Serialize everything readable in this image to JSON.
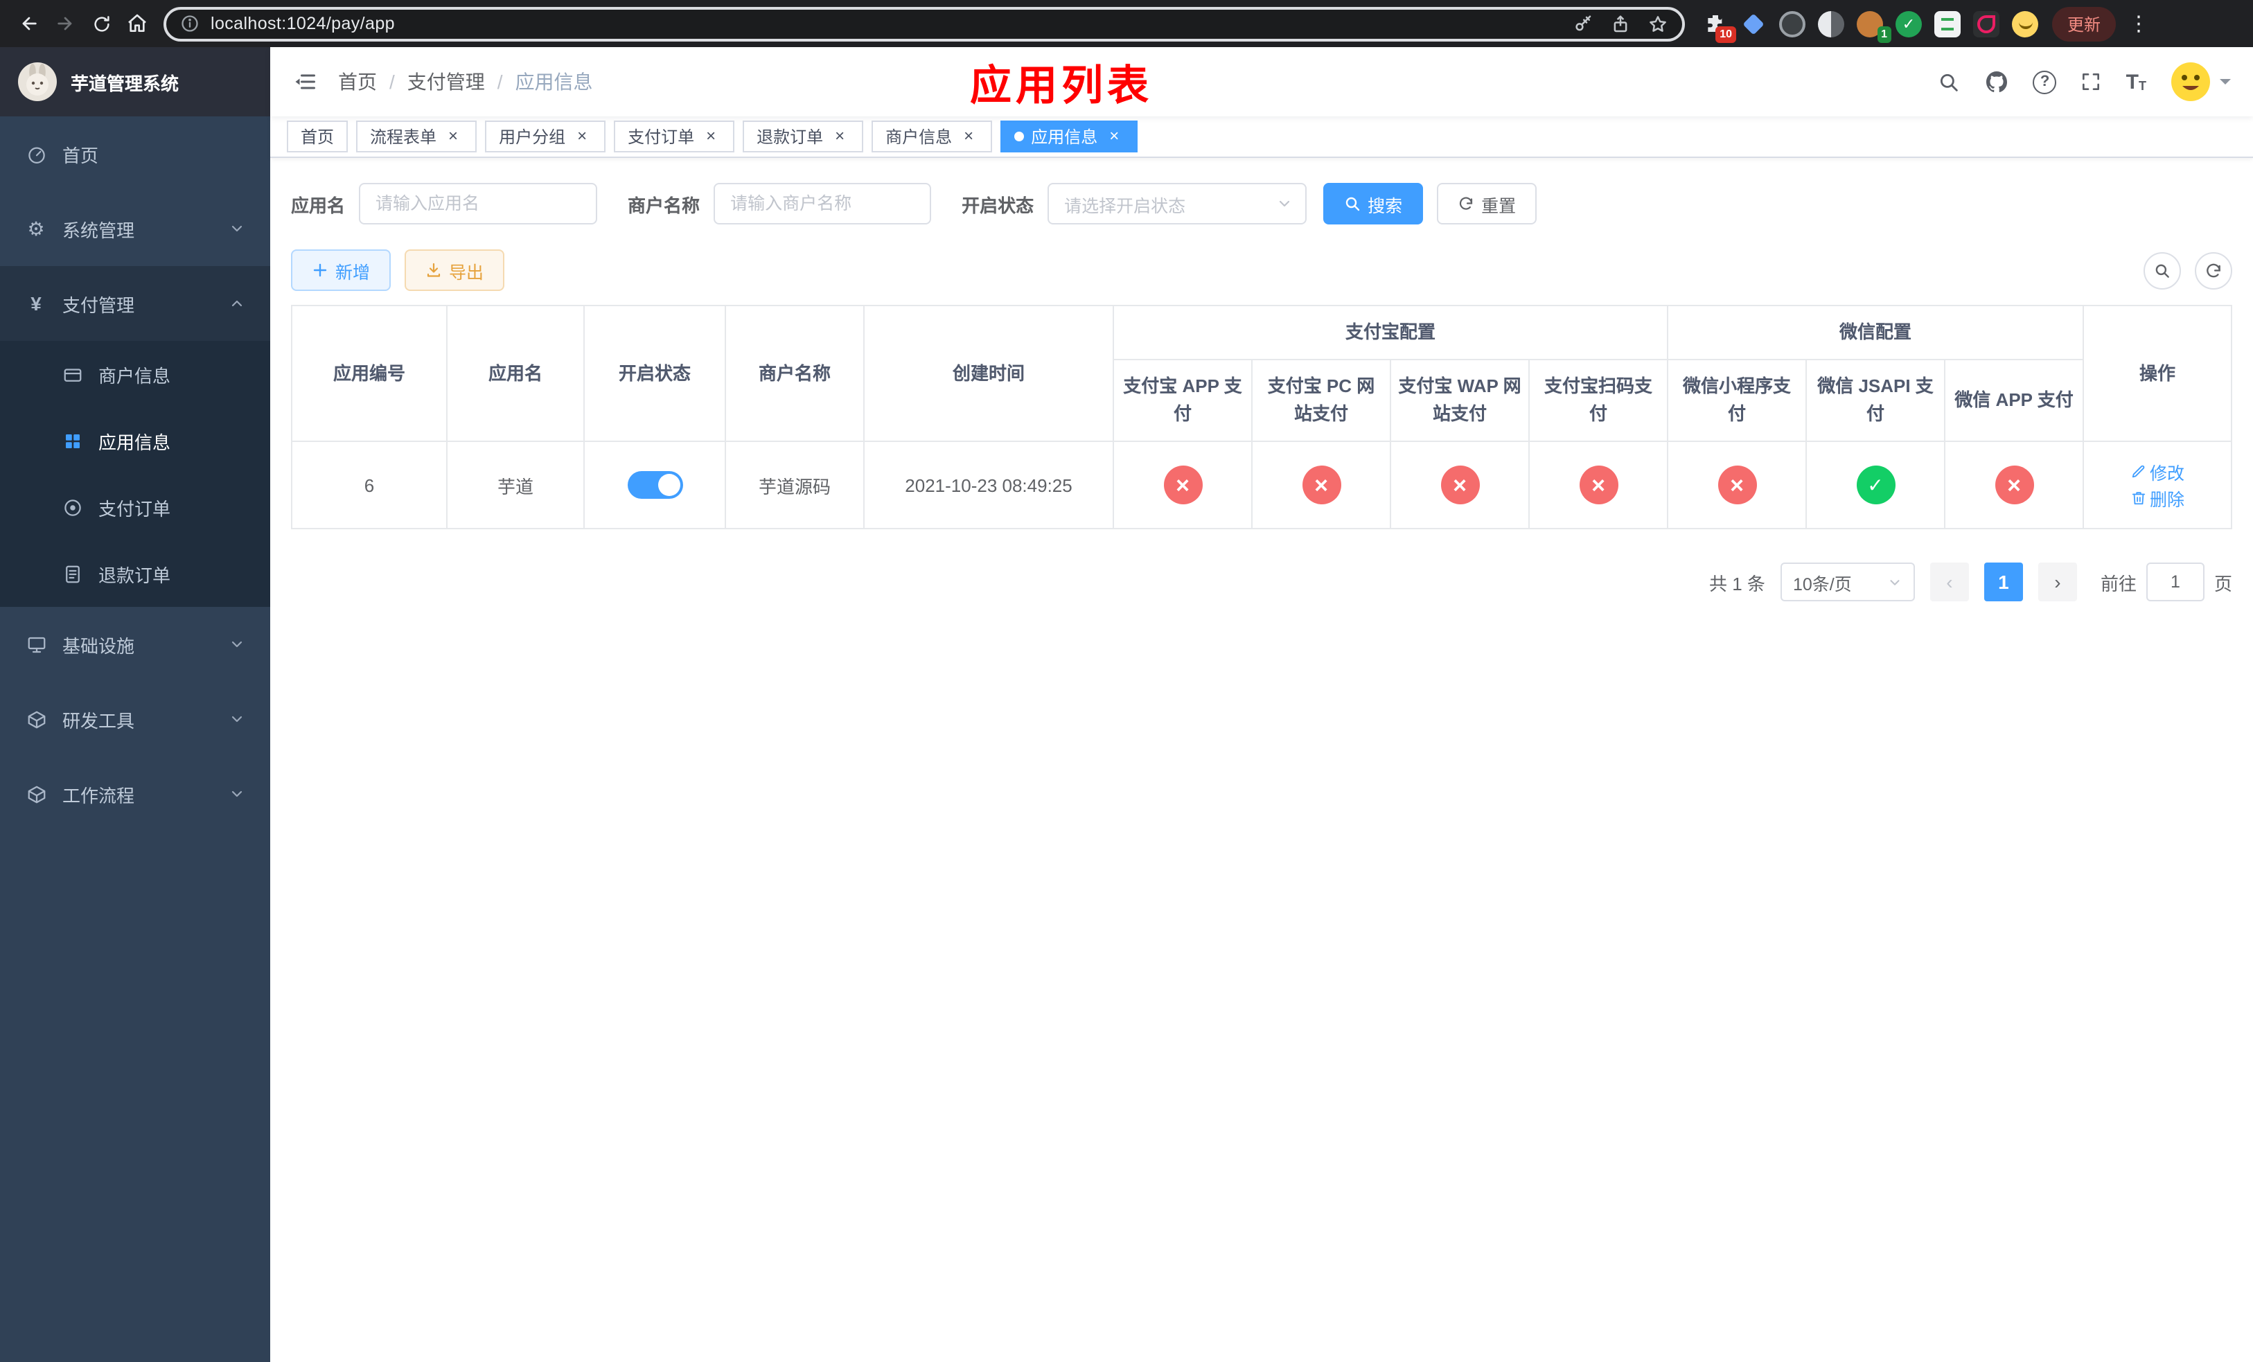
{
  "colors": {
    "accent": "#409eff",
    "success": "#13ce66",
    "danger": "#f56c6c",
    "warning": "#e6a23c",
    "annotation": "#ff0000",
    "sidebar_bg": "#304156"
  },
  "browser": {
    "url": "localhost:1024/pay/app",
    "update_button": "更新",
    "extensions_badge": "10",
    "profile_badge": "1"
  },
  "sidebar": {
    "logo_title": "芋道管理系统",
    "items": {
      "home": "首页",
      "system": "系统管理",
      "payment": "支付管理",
      "merchant": "商户信息",
      "app": "应用信息",
      "pay_order": "支付订单",
      "refund_order": "退款订单",
      "infra": "基础设施",
      "dev_tools": "研发工具",
      "workflow": "工作流程"
    }
  },
  "header": {
    "breadcrumb": [
      "首页",
      "支付管理",
      "应用信息"
    ],
    "annotation": "应用列表"
  },
  "tabs": [
    {
      "label": "首页"
    },
    {
      "label": "流程表单"
    },
    {
      "label": "用户分组"
    },
    {
      "label": "支付订单"
    },
    {
      "label": "退款订单"
    },
    {
      "label": "商户信息"
    },
    {
      "label": "应用信息"
    }
  ],
  "filters": {
    "app_name_label": "应用名",
    "app_name_placeholder": "请输入应用名",
    "merchant_label": "商户名称",
    "merchant_placeholder": "请输入商户名称",
    "status_label": "开启状态",
    "status_placeholder": "请选择开启状态",
    "search_button": "搜索",
    "reset_button": "重置"
  },
  "toolbar": {
    "add_button": "新增",
    "export_button": "导出"
  },
  "table": {
    "group_headers": {
      "alipay": "支付宝配置",
      "wechat": "微信配置"
    },
    "columns": [
      "应用编号",
      "应用名",
      "开启状态",
      "商户名称",
      "创建时间",
      "支付宝 APP 支付",
      "支付宝 PC 网站支付",
      "支付宝 WAP 网站支付",
      "支付宝扫码支付",
      "微信小程序支付",
      "微信 JSAPI 支付",
      "微信 APP 支付",
      "操作"
    ],
    "rows": [
      {
        "id": "6",
        "name": "芋道",
        "enabled": true,
        "merchant": "芋道源码",
        "created": "2021-10-23 08:49:25",
        "alipay_app": false,
        "alipay_pc": false,
        "alipay_wap": false,
        "alipay_qr": false,
        "wechat_mini": false,
        "wechat_jsapi": true,
        "wechat_app": false,
        "edit_label": "修改",
        "delete_label": "删除"
      }
    ]
  },
  "pagination": {
    "total": "共 1 条",
    "page_size": "10条/页",
    "current_page": "1",
    "goto_label": "前往",
    "goto_value": "1",
    "page_unit": "页"
  }
}
